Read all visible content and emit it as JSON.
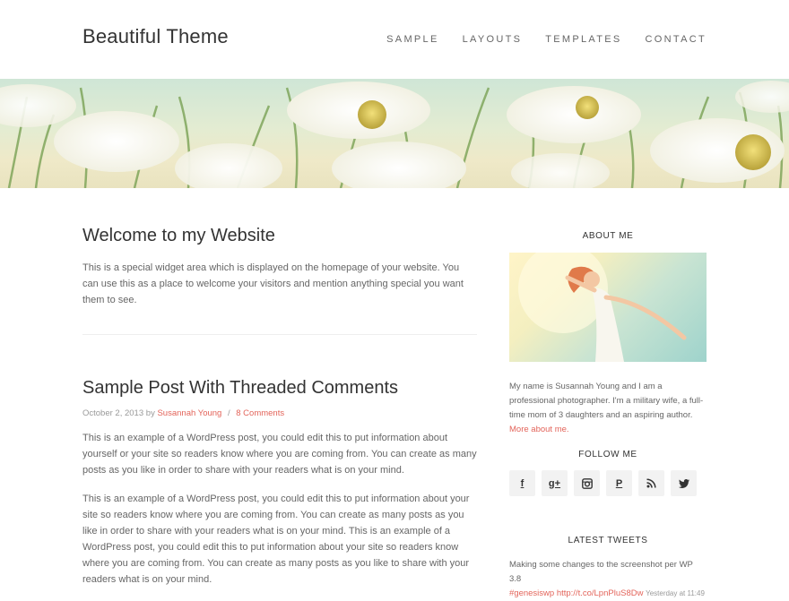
{
  "header": {
    "site_title": "Beautiful Theme",
    "nav": [
      {
        "label": "SAMPLE"
      },
      {
        "label": "LAYOUTS"
      },
      {
        "label": "TEMPLATES"
      },
      {
        "label": "CONTACT"
      }
    ]
  },
  "welcome": {
    "title": "Welcome to my Website",
    "text": "This is a special widget area which is displayed on the homepage of your website. You can use this as a place to welcome your visitors and mention anything special you want them to see."
  },
  "post": {
    "title": "Sample Post With Threaded Comments",
    "date": "October 2, 2013",
    "by": "by",
    "author": "Susannah Young",
    "separator": "/",
    "comments": "8 Comments",
    "paragraphs": [
      "This is an example of a WordPress post, you could edit this to put information about yourself or your site so readers know where you are coming from. You can create as many posts as you like in order to share with your readers what is on your mind.",
      "This is an example of a WordPress post, you could edit this to put information about your site so readers know where you are coming from. You can create as many posts as you like in order to share with your readers what is on your mind. This is an example of a WordPress post, you could edit this to put information about your site so readers know where you are coming from. You can create as many posts as you like to share with your readers what is on your mind."
    ]
  },
  "sidebar": {
    "about_title": "ABOUT ME",
    "about_text": "My name is Susannah Young and I am a professional photographer. I'm a military wife, a full-time mom of 3 daughters and an aspiring author.",
    "about_link": "More about me.",
    "follow_title": "FOLLOW ME",
    "social": [
      {
        "icon": "facebook-icon",
        "glyph": "f"
      },
      {
        "icon": "google-plus-icon",
        "glyph": "g+"
      },
      {
        "icon": "instagram-icon",
        "glyph": ""
      },
      {
        "icon": "pinterest-icon",
        "glyph": "P"
      },
      {
        "icon": "rss-icon",
        "glyph": ""
      },
      {
        "icon": "twitter-icon",
        "glyph": ""
      }
    ],
    "tweets_title": "LATEST TWEETS",
    "tweet": {
      "text": "Making some changes to the screenshot per WP 3.8",
      "hashtag": "#genesiswp",
      "link": "http://t.co/LpnPluS8Dw",
      "time": "Yesterday at 11:49"
    }
  },
  "colors": {
    "accent": "#e3645a",
    "heading": "#333333",
    "body_text": "#666666",
    "muted": "#999999",
    "social_bg": "#f2f2f2"
  }
}
